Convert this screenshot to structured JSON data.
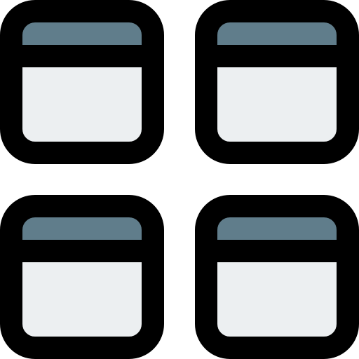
{
  "icon": {
    "name": "window-grid-icon",
    "tiles": [
      {
        "name": "window-tile-top-left"
      },
      {
        "name": "window-tile-top-right"
      },
      {
        "name": "window-tile-bottom-left"
      },
      {
        "name": "window-tile-bottom-right"
      }
    ]
  },
  "colors": {
    "outline": "#000000",
    "header_fill": "#607D8B",
    "body_fill": "#ECEFF1",
    "background": "#FFFFFF"
  }
}
